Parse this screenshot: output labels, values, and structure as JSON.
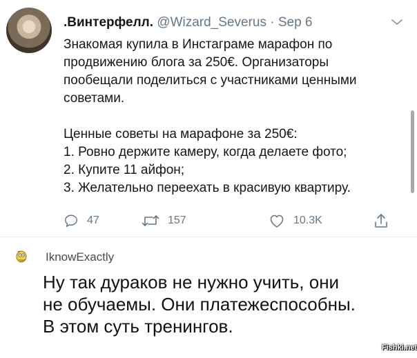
{
  "tweet": {
    "display_name": ".Винтерфелл.",
    "handle": "@Wizard_Severus",
    "separator": "·",
    "date": "Sep 6",
    "lines": [
      "Знакомая купила в Инстаграме марафон по",
      "продвижению блога за 250€. Организаторы",
      "пообещали поделиться с участниками ценными",
      "советами.",
      "",
      "Ценные советы на марафоне за 250€:",
      "1. Ровно держите камеру, когда делаете фото;",
      "2. Купите 11 айфон;",
      "3. Желательно переехать в красивую квартиру."
    ],
    "actions": {
      "reply_count": "47",
      "retweet_count": "157",
      "like_count": "10.3K"
    }
  },
  "comment": {
    "username": "IknowExactly",
    "lines": [
      "Ну так дураков не нужно учить, они",
      "не обучаемы. Они платежеспособны.",
      "В этом суть тренингов."
    ]
  },
  "watermark": "Fishki.net",
  "colors": {
    "secondary_text": "#657786",
    "divider": "#e6ecf0"
  },
  "icons": [
    "chevron-down-icon",
    "reply-icon",
    "retweet-icon",
    "like-icon",
    "share-icon",
    "homer-avatar-icon"
  ]
}
